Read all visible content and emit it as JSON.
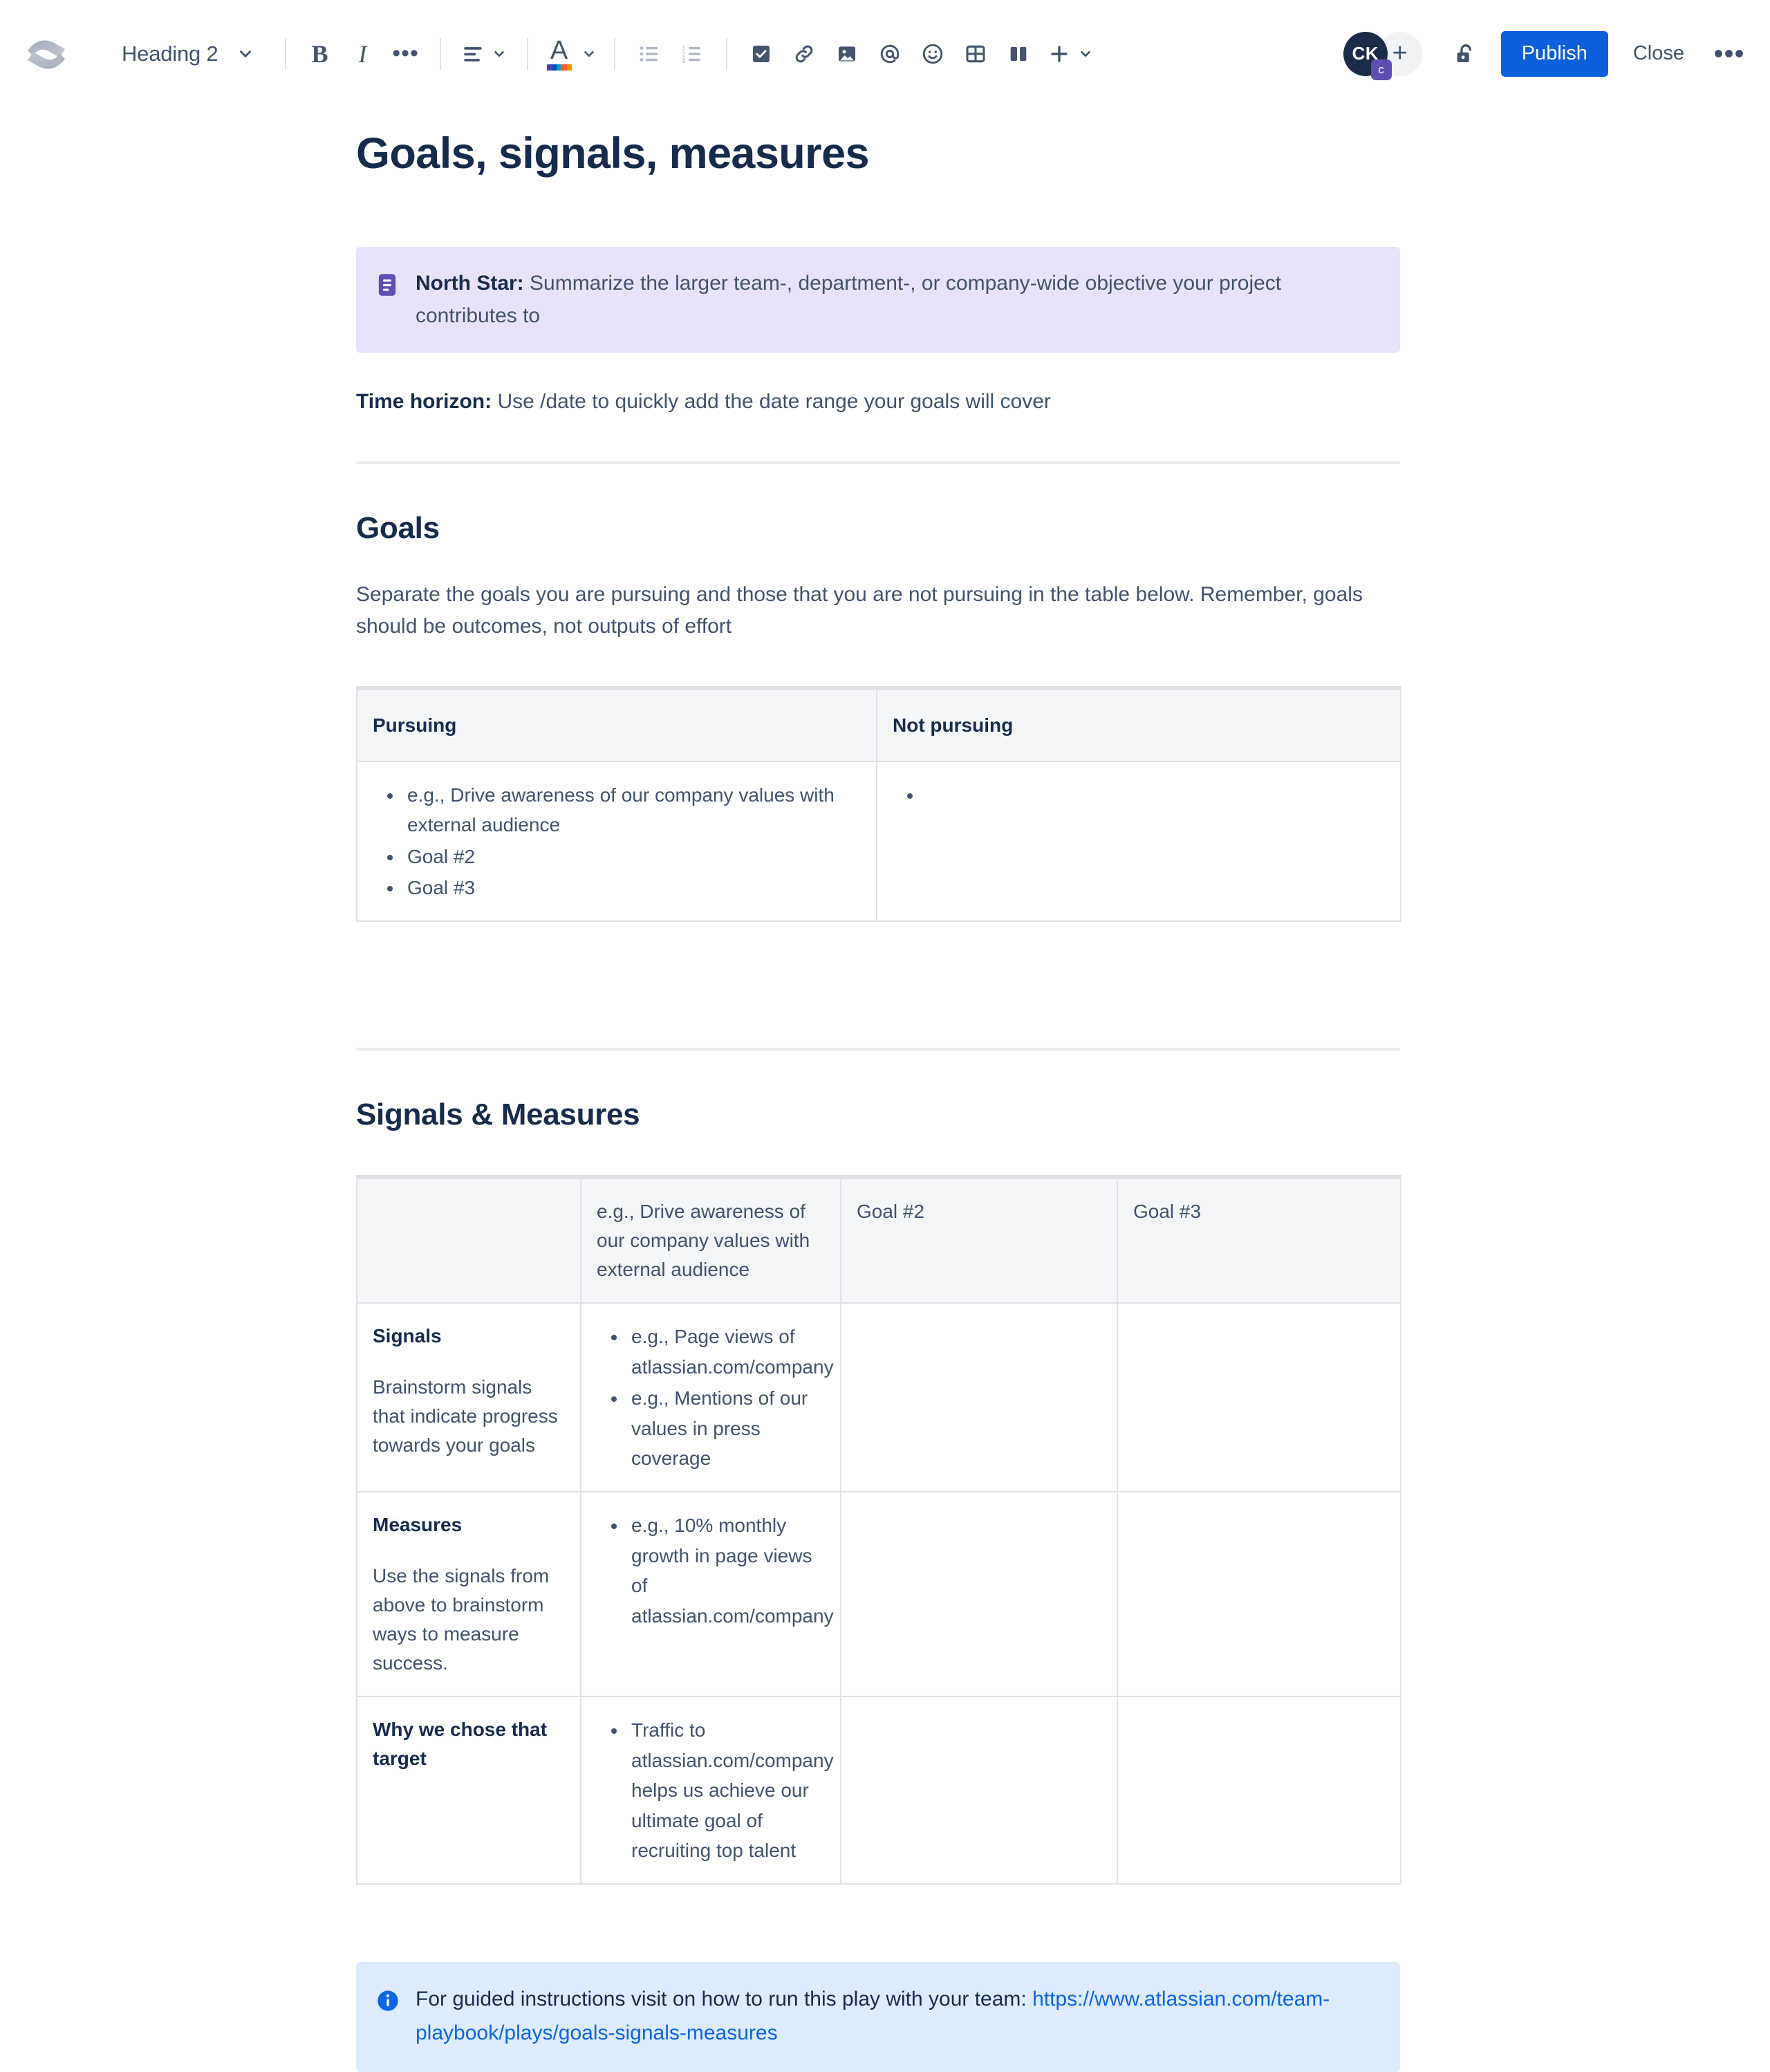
{
  "toolbar": {
    "logo_name": "atlassian-confluence-logo",
    "style_select": {
      "label": "Heading 2"
    },
    "buttons": [
      {
        "name": "bold-button",
        "label": "B"
      },
      {
        "name": "italic-button",
        "label": "I"
      },
      {
        "name": "more-formatting-button",
        "label": "•••"
      }
    ],
    "align_label": "align-left-icon",
    "text_color_label": "A",
    "icons": [
      "bullet-list-icon",
      "numbered-list-icon",
      "task-list-icon",
      "link-icon",
      "image-icon",
      "mention-icon",
      "emoji-icon",
      "table-icon",
      "layout-icon",
      "insert-more-icon"
    ],
    "avatar": {
      "initials": "CK",
      "badge": "c"
    },
    "add_person_label": "+",
    "lock_label": "unlock-icon",
    "publish_label": "Publish",
    "close_label": "Close",
    "more_label": "•••"
  },
  "document": {
    "title": "Goals, signals, measures",
    "north_star": {
      "label": "North Star:",
      "text": " Summarize the larger team-, department-, or company-wide objective your project contributes to"
    },
    "time_horizon": {
      "label": "Time horizon:",
      "text": " Use /date to quickly add the date range your goals will cover"
    },
    "goals": {
      "heading": "Goals",
      "intro": "Separate the goals you are pursuing and those that you are not pursuing in the table below. Remember, goals should be outcomes, not outputs of effort",
      "table": {
        "headers": [
          "Pursuing",
          "Not pursuing"
        ],
        "pursuing_items": [
          "e.g., Drive awareness of our company values with external audience",
          "Goal #2",
          "Goal #3"
        ],
        "not_pursuing_items": [
          ""
        ]
      }
    },
    "signals_measures": {
      "heading": "Signals & Measures",
      "table": {
        "headers": [
          "",
          "e.g., Drive awareness of our company values with external audience",
          "Goal #2",
          "Goal #3"
        ],
        "rows": [
          {
            "title": "Signals",
            "description": "Brainstorm signals that indicate progress towards your goals",
            "col1_items": [
              "e.g., Page views of atlassian.com/company",
              "e.g., Mentions of our values in press coverage"
            ],
            "col2_items": [],
            "col3_items": []
          },
          {
            "title": "Measures",
            "description": "Use the signals from above to brainstorm ways to measure success.",
            "col1_items": [
              "e.g., 10% monthly growth in page views of atlassian.com/company"
            ],
            "col2_items": [],
            "col3_items": []
          },
          {
            "title": "Why we chose that target",
            "description": "",
            "col1_items": [
              "Traffic to atlassian.com/company helps us achieve our ultimate goal of recruiting top talent"
            ],
            "col2_items": [],
            "col3_items": []
          }
        ]
      }
    },
    "footer_note": {
      "text": "For guided instructions visit on how to run this play with your team: ",
      "link_text": "https://www.atlassian.com/team-playbook/plays/goals-signals-measures"
    }
  },
  "colors": {
    "accent": "#0C5EDA",
    "panel_purple": "#E9E2FB",
    "panel_blue": "#DEEBFF",
    "link": "#0C66E4",
    "text": "#172B4D",
    "text_muted": "#42526E",
    "border": "#DFE1E6",
    "table_header_bg": "#F4F5F7"
  }
}
